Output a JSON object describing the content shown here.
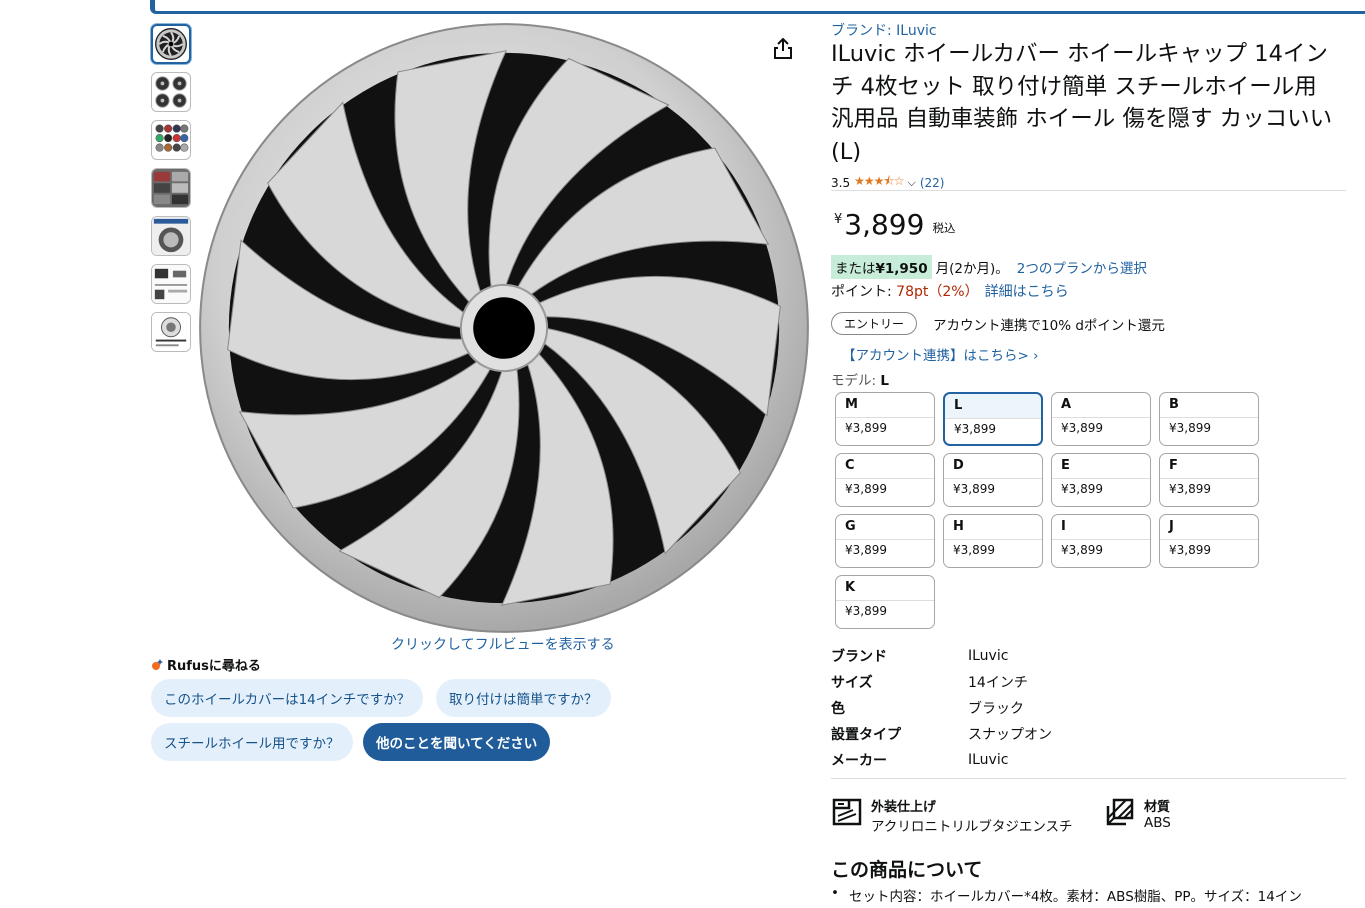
{
  "thumbnails": [
    {
      "label": "wheel cover front"
    },
    {
      "label": "set of four"
    },
    {
      "label": "color variants"
    },
    {
      "label": "installed on cars"
    },
    {
      "label": "installation"
    },
    {
      "label": "detail views"
    },
    {
      "label": "size chart"
    }
  ],
  "main_image": {
    "fullview_link": "クリックしてフルビューを表示する"
  },
  "rufus": {
    "title": "Rufusに尋ねる",
    "chips": [
      "このホイールカバーは14インチですか？",
      "取り付けは簡単ですか？",
      "スチールホイール用ですか？",
      "他のことを聞いてください"
    ]
  },
  "product": {
    "brand_link": "ブランド: ILuvic",
    "title": "ILuvic ホイールカバー ホイールキャップ 14インチ 4枚セット 取り付け簡単 スチールホイール用 汎用品 自動車装飾 ホイール 傷を隠す カッコいい (L)",
    "rating": "3.5",
    "stars": "★★★⯪☆",
    "review_count": "(22)",
    "price_symbol": "¥",
    "price": "3,899",
    "price_tax": "税込",
    "installment_prefix": "または",
    "installment_amount": "¥1,950",
    "installment_suffix": "月(2か月)。",
    "installment_link": "2つのプランから選択",
    "points_label": "ポイント: ",
    "points_value": "78pt（2%）",
    "points_link": "詳細はこちら",
    "entry_button": "エントリー",
    "entry_text": "アカウント連携で10% dポイント還元",
    "account_link": "【アカウント連携】はこちら> ›",
    "model_label": "モデル: ",
    "model_selected": "L"
  },
  "options": [
    {
      "name": "M",
      "price": "¥3,899"
    },
    {
      "name": "L",
      "price": "¥3,899"
    },
    {
      "name": "A",
      "price": "¥3,899"
    },
    {
      "name": "B",
      "price": "¥3,899"
    },
    {
      "name": "C",
      "price": "¥3,899"
    },
    {
      "name": "D",
      "price": "¥3,899"
    },
    {
      "name": "E",
      "price": "¥3,899"
    },
    {
      "name": "F",
      "price": "¥3,899"
    },
    {
      "name": "G",
      "price": "¥3,899"
    },
    {
      "name": "H",
      "price": "¥3,899"
    },
    {
      "name": "I",
      "price": "¥3,899"
    },
    {
      "name": "J",
      "price": "¥3,899"
    },
    {
      "name": "K",
      "price": "¥3,899"
    }
  ],
  "specs": [
    {
      "key": "ブランド",
      "value": "ILuvic"
    },
    {
      "key": "サイズ",
      "value": "14インチ"
    },
    {
      "key": "色",
      "value": "ブラック"
    },
    {
      "key": "設置タイプ",
      "value": "スナップオン"
    },
    {
      "key": "メーカー",
      "value": "ILuvic"
    }
  ],
  "features": [
    {
      "title": "外装仕上げ",
      "value": "アクリロニトリルブタジエンスチ",
      "icon": "finish-icon"
    },
    {
      "title": "材質",
      "value": "ABS",
      "icon": "material-icon"
    }
  ],
  "about": {
    "title": "この商品について",
    "first_item": "セット内容：ホイールカバー*4枚。素材：ABS樹脂、PP。サイズ：14イン"
  },
  "colors": {
    "link": "#2162a1",
    "price_red": "#b12704",
    "star": "#de7921",
    "install_bg": "#c7ecd8",
    "rufus_chip": "#e3f0fb",
    "rufus_chip_dark": "#1f5c99"
  }
}
